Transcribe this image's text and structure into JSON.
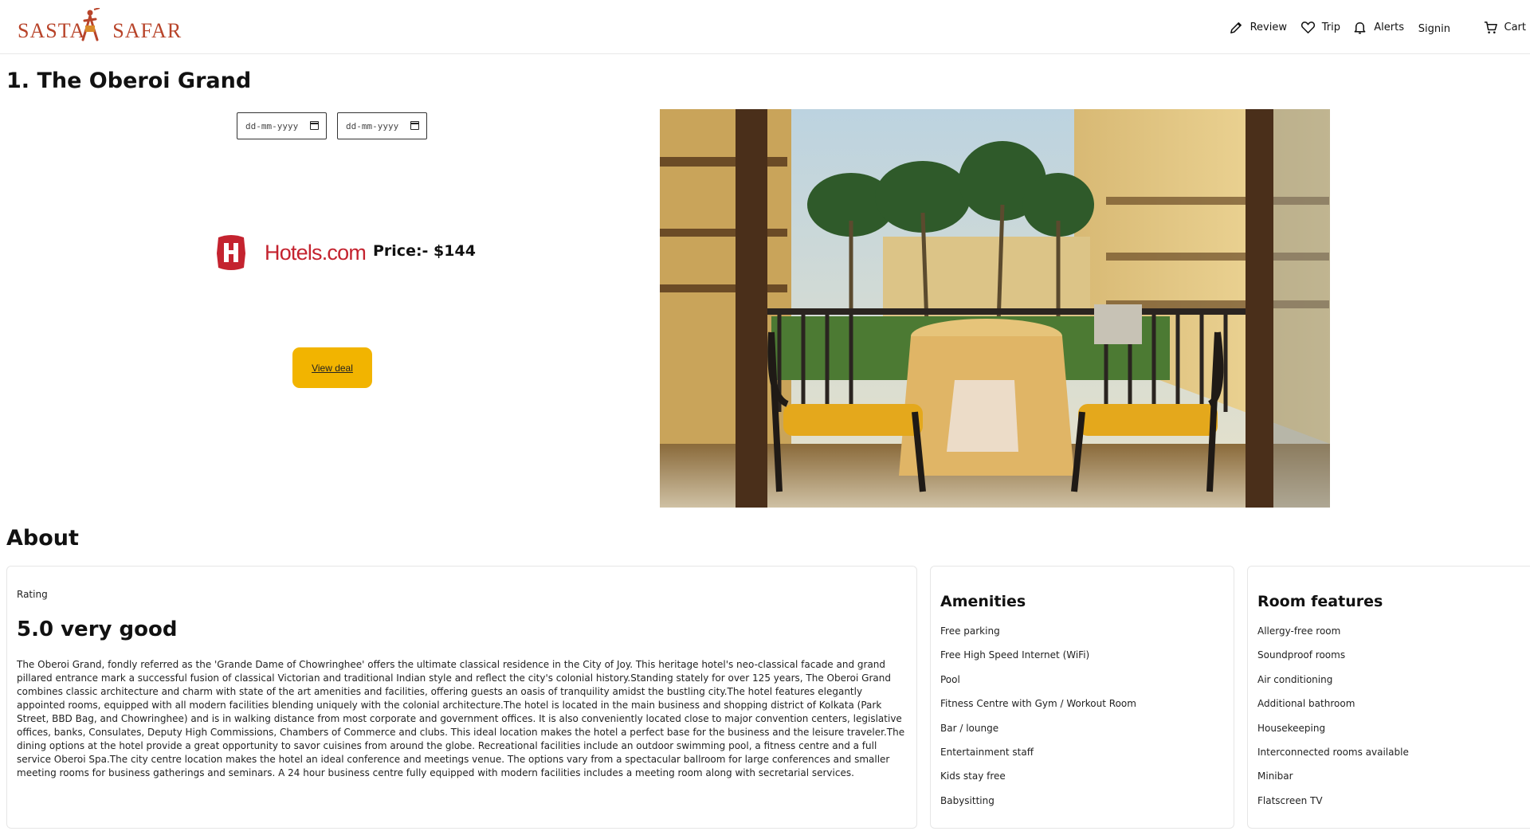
{
  "header": {
    "logo_text": "SASTA SAFAR",
    "logo_word1": "SASTA",
    "logo_word2": "SAFAR",
    "nav": [
      {
        "label": "Review",
        "icon": "pencil-icon"
      },
      {
        "label": "Trip",
        "icon": "heart-icon"
      },
      {
        "label": "Alerts",
        "icon": "bell-icon"
      },
      {
        "label": "Signin",
        "icon": ""
      },
      {
        "label": "Cart",
        "icon": "cart-icon"
      }
    ]
  },
  "hotel": {
    "title": "1. The Oberoi Grand",
    "checkin_placeholder": "dd-mm-yyyy",
    "checkout_placeholder": "dd-mm-yyyy",
    "provider": "Hotels.com",
    "price_label": "Price:- $144",
    "view_deal_label": "View deal"
  },
  "about": {
    "heading": "About",
    "rating_label": "Rating",
    "rating_value": "5.0 very good",
    "description": "The Oberoi Grand, fondly referred as the 'Grande Dame of Chowringhee' offers the ultimate classical residence in the City of Joy. This heritage hotel's neo-classical facade and grand pillared entrance mark a successful fusion of classical Victorian and traditional Indian style and reflect the city's colonial history.Standing stately for over 125 years, The Oberoi Grand combines classic architecture and charm with state of the art amenities and facilities, offering guests an oasis of tranquility amidst the bustling city.The hotel features elegantly appointed rooms, equipped with all modern facilities blending uniquely with the colonial architecture.The hotel is located in the main business and shopping district of Kolkata (Park Street, BBD Bag, and Chowringhee) and is in walking distance from most corporate and government offices. It is also conveniently located close to major convention centers, legislative offices, banks, Consulates, Deputy High Commissions, Chambers of Commerce and clubs. This ideal location makes the hotel a perfect base for the business and the leisure traveler.The dining options at the hotel provide a great opportunity to savor cuisines from around the globe. Recreational facilities include an outdoor swimming pool, a fitness centre and a full service Oberoi Spa.The city centre location makes the hotel an ideal conference and meetings venue. The options vary from a spectacular ballroom for large conferences and smaller meeting rooms for business gatherings and seminars. A 24 hour business centre fully equipped with modern facilities includes a meeting room along with secretarial services."
  },
  "amenities": {
    "title": "Amenities",
    "items": [
      "Free parking",
      "Free High Speed Internet (WiFi)",
      "Pool",
      "Fitness Centre with Gym / Workout Room",
      "Bar / lounge",
      "Entertainment staff",
      "Kids stay free",
      "Babysitting"
    ]
  },
  "room_features": {
    "title": "Room features",
    "items": [
      "Allergy-free room",
      "Soundproof rooms",
      "Air conditioning",
      "Additional bathroom",
      "Housekeeping",
      "Interconnected rooms available",
      "Minibar",
      "Flatscreen TV"
    ]
  },
  "colors": {
    "logo": "#b8442a",
    "hotels_brand": "#c4232f",
    "view_deal_bg": "#f2b400"
  }
}
